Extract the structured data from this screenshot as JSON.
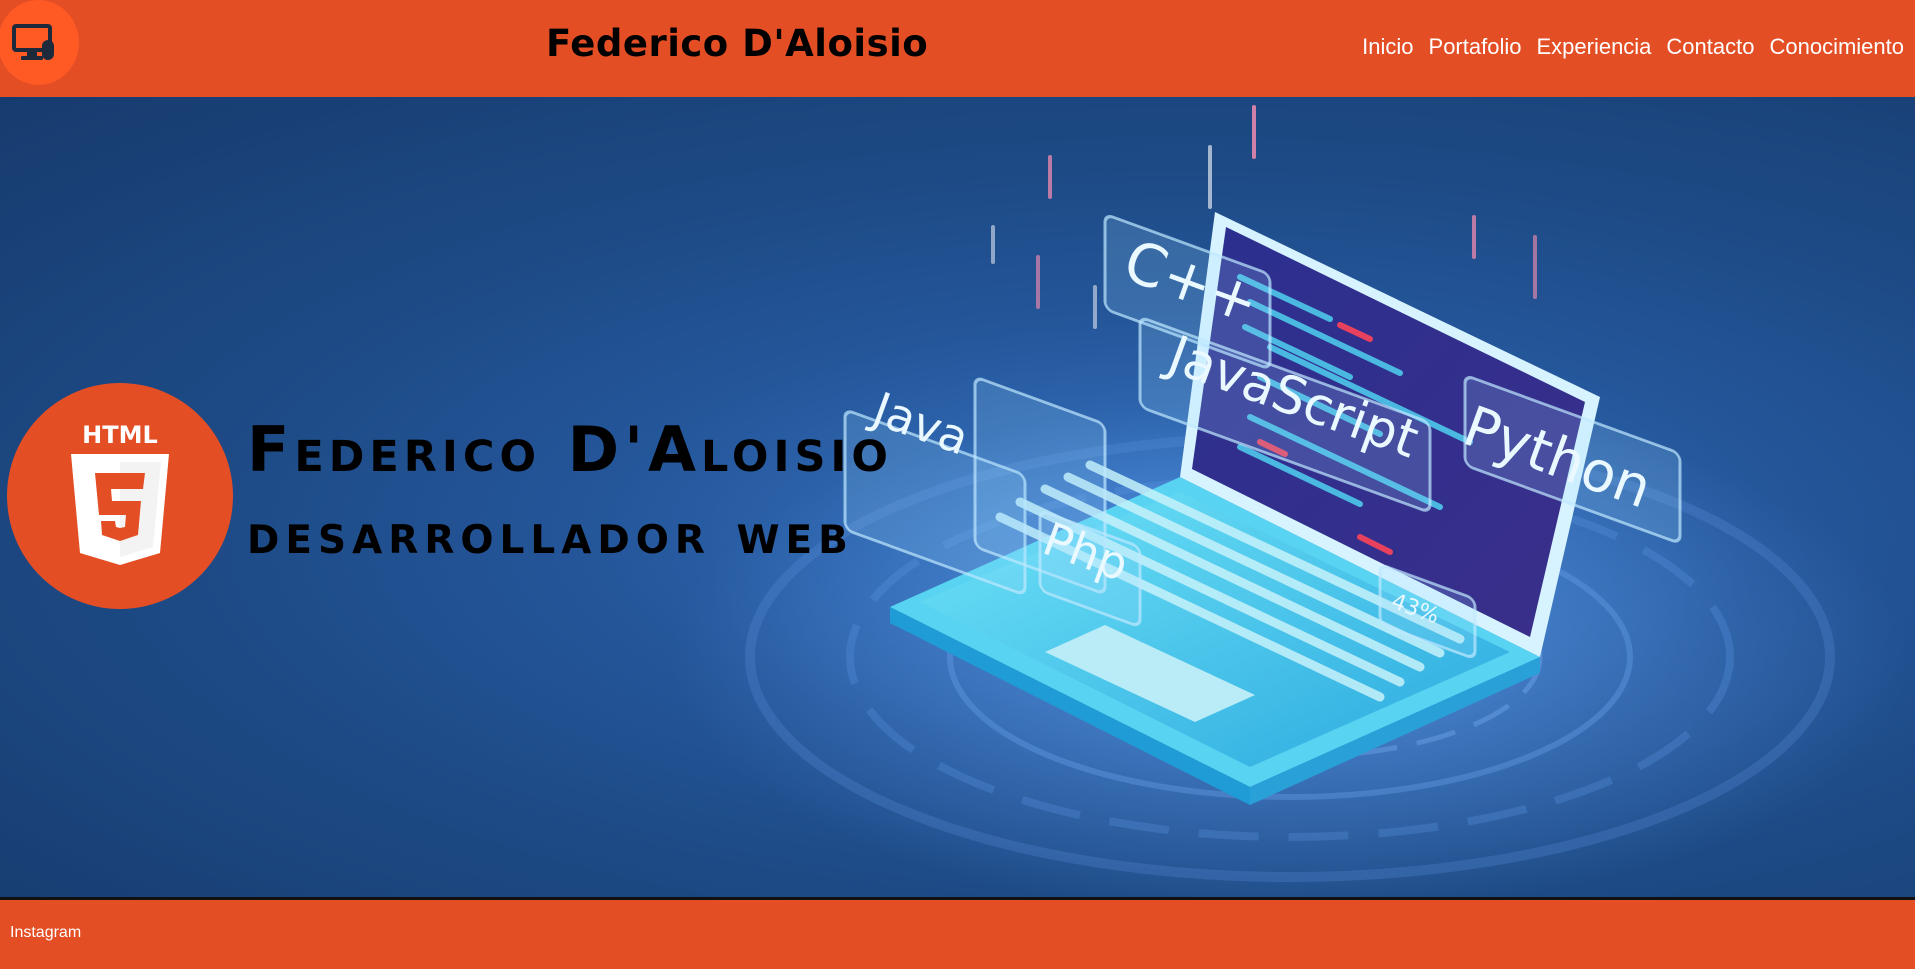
{
  "header": {
    "logo_icon": "computer-mouse-icon",
    "title": "Federico D'Aloisio",
    "nav": [
      {
        "label": "Inicio"
      },
      {
        "label": "Portafolio"
      },
      {
        "label": "Experiencia"
      },
      {
        "label": "Contacto"
      },
      {
        "label": "Conocimiento"
      }
    ]
  },
  "hero": {
    "badge_icon": "html5-icon",
    "badge_text": "HTML",
    "name": "Federico D'Aloisio",
    "role": "desarrollador web",
    "art_labels": [
      "C++",
      "JavaScript",
      "Python",
      "Java",
      "Php",
      "43%"
    ]
  },
  "footer": {
    "link": "Instagram"
  },
  "colors": {
    "brand": "#e44e25",
    "hero_bg": "#1d4a85"
  }
}
